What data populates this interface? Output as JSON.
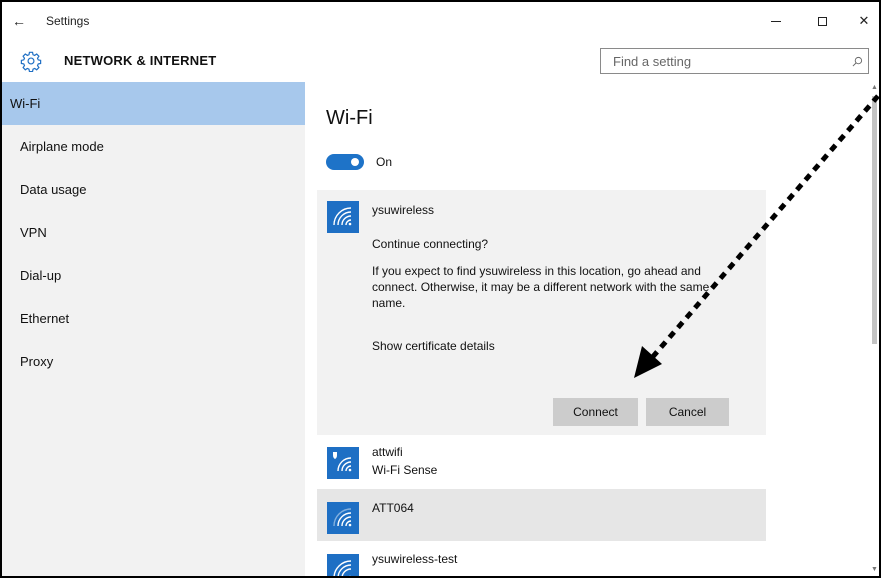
{
  "window": {
    "title": "Settings",
    "back_glyph": "←",
    "close_glyph": "✕"
  },
  "header": {
    "section_title": "NETWORK & INTERNET",
    "search_placeholder": "Find a setting"
  },
  "sidebar": {
    "items": [
      {
        "label": "Wi-Fi",
        "active": true
      },
      {
        "label": "Airplane mode"
      },
      {
        "label": "Data usage"
      },
      {
        "label": "VPN"
      },
      {
        "label": "Dial-up"
      },
      {
        "label": "Ethernet"
      },
      {
        "label": "Proxy"
      }
    ]
  },
  "main": {
    "title": "Wi-Fi",
    "toggle_label": "On",
    "expanded_network": {
      "name": "ysuwireless",
      "question": "Continue connecting?",
      "description": "If you expect to find ysuwireless in this location, go ahead and connect. Otherwise, it may be a different network with the same name.",
      "cert_link": "Show certificate details",
      "connect_label": "Connect",
      "cancel_label": "Cancel"
    },
    "networks": [
      {
        "name": "attwifi",
        "sub": "Wi-Fi Sense"
      },
      {
        "name": "ATT064"
      },
      {
        "name": "ysuwireless-test"
      }
    ]
  },
  "colors": {
    "accent": "#1e73c8",
    "sidebar_selected": "#a7c8ec",
    "sidebar_bg": "#f2f2f2"
  }
}
